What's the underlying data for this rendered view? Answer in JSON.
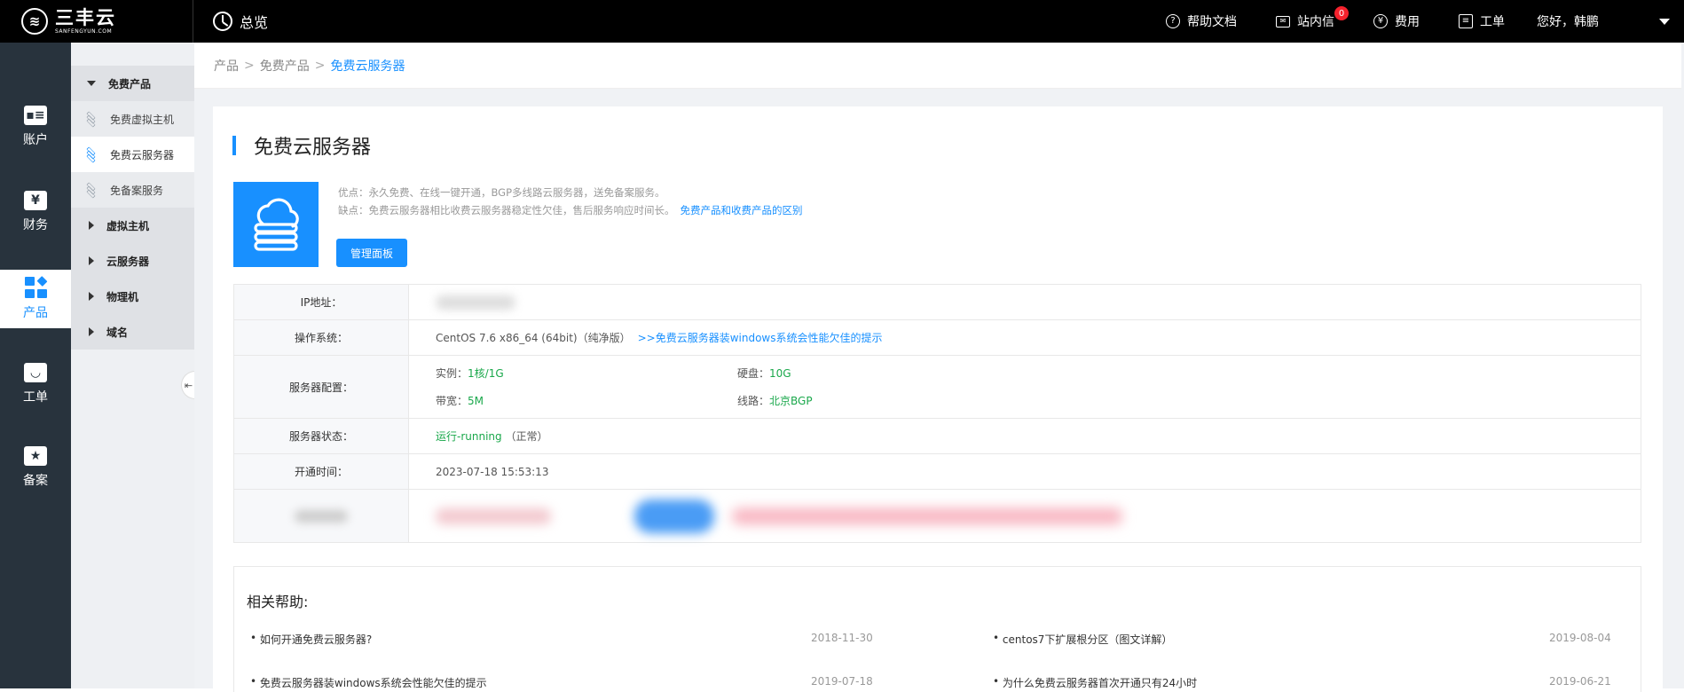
{
  "topbar": {
    "logo_cn": "三丰云",
    "logo_en": "SANFENGYUN.COM",
    "overview": "总览",
    "help_docs": "帮助文档",
    "messages": "站内信",
    "messages_badge": "0",
    "fees": "费用",
    "tickets": "工单",
    "greeting": "您好，韩鹏"
  },
  "rail": [
    {
      "label": "账户",
      "icon": "id-card-icon"
    },
    {
      "label": "财务",
      "icon": "yen-icon"
    },
    {
      "label": "产品",
      "icon": "product-grid-icon",
      "active": true
    },
    {
      "label": "工单",
      "icon": "bag-icon"
    },
    {
      "label": "备案",
      "icon": "filing-star-icon"
    }
  ],
  "submenu": {
    "free": "免费产品",
    "free_vhost": "免费虚拟主机",
    "free_cloud": "免费云服务器",
    "free_beian": "免备案服务",
    "vhost": "虚拟主机",
    "cloud": "云服务器",
    "physical": "物理机",
    "domain": "域名"
  },
  "breadcrumb": {
    "root": "产品",
    "mid": "免费产品",
    "current": "免费云服务器",
    "sep": ">"
  },
  "page": {
    "title": "免费云服务器",
    "pros": "优点：永久免费、在线一键开通，BGP多线路云服务器，送免备案服务。",
    "cons": "缺点：免费云服务器相比收费云服务器稳定性欠佳，售后服务响应时间长。",
    "diff_link": "免费产品和收费产品的区别",
    "manage_button": "管理面板"
  },
  "info": {
    "ip_label": "IP地址：",
    "os_label": "操作系统：",
    "os_value": "CentOS 7.6 x86_64 (64bit)（纯净版）",
    "os_link": ">>免费云服务器装windows系统会性能欠佳的提示",
    "config_label": "服务器配置：",
    "instance_label": "实例：",
    "instance_value": "1核/1G",
    "disk_label": "硬盘：",
    "disk_value": "10G",
    "bandwidth_label": "带宽：",
    "bandwidth_value": "5M",
    "line_label": "线路：",
    "line_value": "北京BGP",
    "status_label": "服务器状态：",
    "status_value": "运行-running",
    "status_note": "（正常）",
    "open_label": "开通时间：",
    "open_value": "2023-07-18 15:53:13"
  },
  "help": {
    "title": "相关帮助:",
    "items": [
      {
        "title": "如何开通免费云服务器?",
        "date": "2018-11-30"
      },
      {
        "title": "centos7下扩展根分区（图文详解）",
        "date": "2019-08-04"
      },
      {
        "title": "免费云服务器装windows系统会性能欠佳的提示",
        "date": "2019-07-18"
      },
      {
        "title": "为什么免费云服务器首次开通只有24小时",
        "date": "2019-06-21"
      }
    ]
  },
  "colors": {
    "accent": "#1890ff",
    "rail": "#28333d",
    "ok_green": "#1aa84b"
  }
}
